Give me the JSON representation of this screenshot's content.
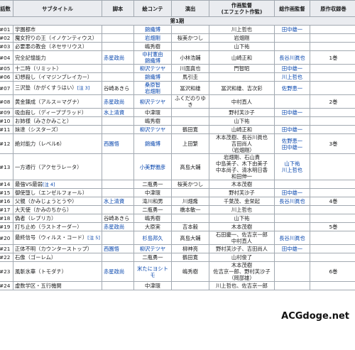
{
  "headers": [
    "話数",
    "サブタイトル",
    "脚本",
    "絵コンテ",
    "演出",
    "作画監督\n(エフェクト作監)",
    "総作画監督",
    "原作収録巻"
  ],
  "section": "第1期",
  "watermark": "ACGdoge.net",
  "rows": [
    {
      "ep": "#01",
      "title": "学園都市",
      "script": "",
      "storyboard": "錦織博",
      "direction": "",
      "sakkan": "川上哲也",
      "sou": "田中雄一",
      "vol": ""
    },
    {
      "ep": "#02",
      "title": "魔女狩りの王（イノケンティウス）",
      "script": "",
      "storyboard": "岩畑剛",
      "direction": "桜美かつし",
      "sakkan": "岩畑剛",
      "sou": "",
      "vol": ""
    },
    {
      "ep": "#03",
      "title": "必要悪の教会（ネセサリウス）",
      "script": "",
      "storyboard": "嶋秀樹",
      "direction": "",
      "sakkan": "山下祐",
      "sou": "",
      "vol": ""
    },
    {
      "ep": "#04",
      "title": "完全記憶能力",
      "script": "赤星政尚",
      "storyboard": "中村憲由\n錦織博",
      "direction": "小林浩輔",
      "sakkan": "山崎正和",
      "sou": "長谷川眞也",
      "vol": "1巻"
    },
    {
      "ep": "#05",
      "title": "十二時（リミット）",
      "script": "",
      "storyboard": "柳沢テツヤ",
      "direction": "川面真也",
      "sakkan": "門智昭",
      "sou": "田中雄一",
      "vol": ""
    },
    {
      "ep": "#06",
      "title": "幻想殺し（イマジンブレイカー）",
      "script": "",
      "storyboard": "錦織博",
      "direction": "馬引圭",
      "sakkan": "",
      "sou": "川上哲也",
      "vol": ""
    },
    {
      "ep": "#07",
      "title": "三沢塾（かがくすうはい）",
      "note": "[注 3]",
      "script": "谷崎あきら",
      "storyboard": "桑原智\n岩畑剛",
      "direction": "冨沢和雄",
      "sakkan": "冨沢和雄、吉次彩",
      "sou": "佐野恵一",
      "vol": ""
    },
    {
      "ep": "#08",
      "title": "黄金錬成（アルス＝マグナ）",
      "script": "赤星政尚",
      "storyboard": "柳沢テツヤ",
      "direction": "ふくだのりゆき",
      "sakkan": "中村直人",
      "sou": "",
      "vol": "2巻"
    },
    {
      "ep": "#09",
      "title": "吸血殺し（ディープブラッド）",
      "script": "水上清資",
      "storyboard": "中津環",
      "direction": "",
      "sakkan": "野村芙沙子",
      "sou": "田中雄一",
      "vol": ""
    },
    {
      "ep": "#10",
      "title": "お姉様（みさかみこと）",
      "script": "",
      "storyboard": "嶋秀樹",
      "direction": "",
      "sakkan": "山下祐",
      "sou": "",
      "vol": ""
    },
    {
      "ep": "#11",
      "title": "妹達（シスターズ）",
      "script": "",
      "storyboard": "柳沢テツヤ",
      "direction": "鶴田寛",
      "sakkan": "山崎正和",
      "sou": "田中雄一",
      "vol": ""
    },
    {
      "ep": "#12",
      "title": "絶対能力（レベル6）",
      "script": "西園悟",
      "storyboard": "錦織博",
      "direction": "上田繁",
      "sakkan": "木本茂樹、長谷川眞也\n吉田尚人\n（岩畑剛）",
      "sou": "佐野恵一\n田中雄一",
      "vol": "3巻"
    },
    {
      "ep": "#13",
      "title": "一方通行（アクセラレータ）",
      "script": "",
      "storyboard": "小美野雅彦",
      "direction": "高島大輔",
      "sakkan": "岩畑剛、石山貴\n中島美子、木下由美子\n中本尚子、清水明日香\n和田伸一",
      "sou": "山下祐\n川上哲也",
      "vol": ""
    },
    {
      "ep": "#14",
      "title": "最強VS最弱",
      "note": "[注 4]",
      "script": "",
      "storyboard": "二瓶勇一",
      "direction": "桜美かつし",
      "sakkan": "木本茂樹",
      "sou": "",
      "vol": ""
    },
    {
      "ep": "#15",
      "title": "御使堕し（エンゼルフォール）",
      "script": "",
      "storyboard": "中津環",
      "direction": "",
      "sakkan": "野村芙沙子",
      "sou": "田中雄一",
      "vol": ""
    },
    {
      "ep": "#16",
      "title": "父親（かみじょうとうや）",
      "script": "水上清資",
      "storyboard": "滝川和男",
      "direction": "川畑喬",
      "sakkan": "千葉茂、金栄起",
      "sou": "長谷川眞也",
      "vol": "4巻"
    },
    {
      "ep": "#17",
      "title": "大天使（かみのちから）",
      "script": "",
      "storyboard": "二瓶勇一",
      "direction": "橋本敏一",
      "sakkan": "川上哲也",
      "sou": "",
      "vol": ""
    },
    {
      "ep": "#18",
      "title": "偽者（レプリカ）",
      "script": "谷崎あきら",
      "storyboard": "嶋秀樹",
      "direction": "",
      "sakkan": "山下祐",
      "sou": "",
      "vol": ""
    },
    {
      "ep": "#19",
      "title": "打ち止め（ラストオーダー）",
      "script": "赤星政尚",
      "storyboard": "大原実",
      "direction": "吉本毅",
      "sakkan": "木本茂樹",
      "sou": "",
      "vol": "5巻"
    },
    {
      "ep": "#20",
      "title": "最終信号（ウィルス・コード）",
      "note": "[注 5]",
      "script": "",
      "storyboard": "杉島邦久",
      "direction": "高島大輔",
      "sakkan": "石田慶一、佐吉京一郎\n中村直人",
      "sou": "長谷川眞也",
      "vol": ""
    },
    {
      "ep": "#21",
      "title": "正体不明（カウンターストップ）",
      "script": "西園悟",
      "storyboard": "柳沢テツヤ",
      "direction": "柳神亮",
      "sakkan": "野村芙沙子、吉田尚人",
      "sou": "田中雄一",
      "vol": ""
    },
    {
      "ep": "#22",
      "title": "石像（ゴーレム）",
      "script": "",
      "storyboard": "二瓶勇一",
      "direction": "鶴田寛",
      "sakkan": "山村俊了",
      "sou": "",
      "vol": ""
    },
    {
      "ep": "#23",
      "title": "風斬氷華（トモダチ）",
      "script": "赤星政尚",
      "storyboard": "米たにヨシトモ",
      "direction": "嶋秀樹",
      "sakkan": "木本茂樹\n佐吉京一郎、野村芙沙子\n（岡部雄）",
      "sou": "",
      "vol": "6巻"
    },
    {
      "ep": "#24",
      "title": "虚数学区・五行機関",
      "script": "",
      "storyboard": "中津環",
      "direction": "",
      "sakkan": "川上哲也、佐吉京一郎",
      "sou": "",
      "vol": ""
    }
  ]
}
